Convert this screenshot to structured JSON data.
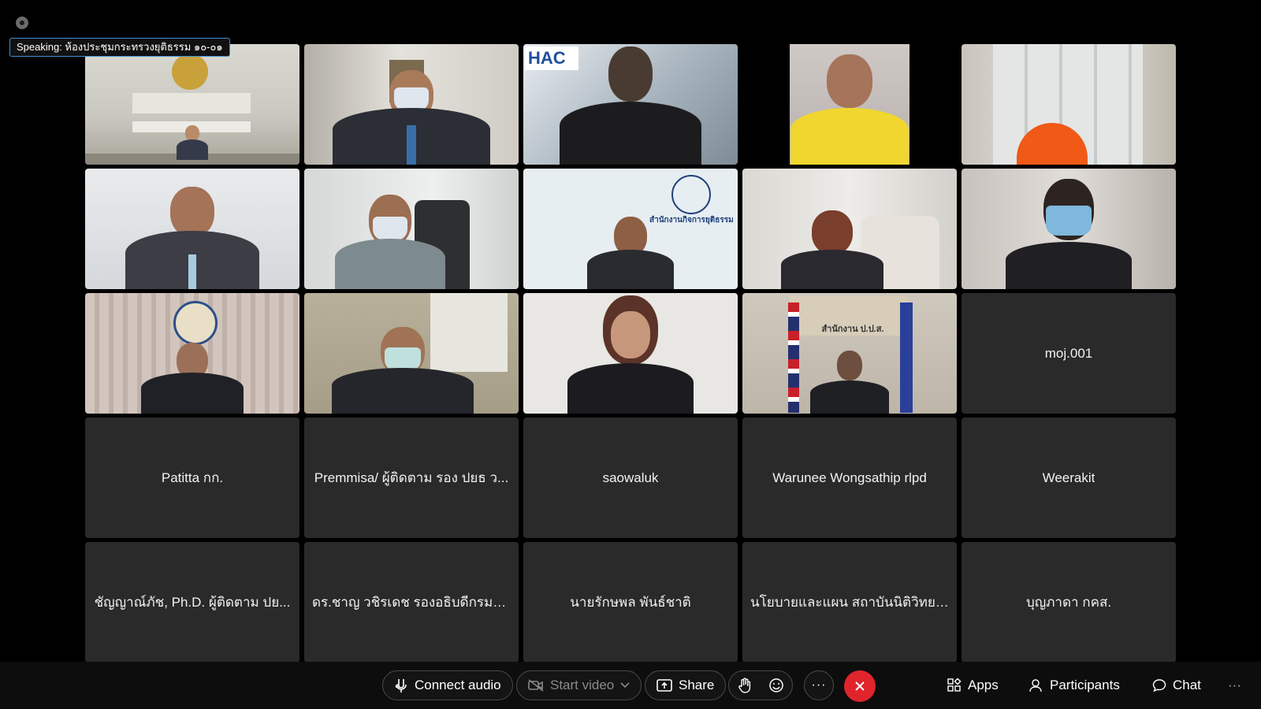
{
  "speaking": {
    "text": "Speaking: ห้องประชุมกระทรวงยุติธรรม ๑๐-๐๑"
  },
  "tiles": [
    {
      "id": "t1"
    },
    {
      "id": "t2",
      "logo": "HAC"
    },
    {
      "id": "t3"
    },
    {
      "id": "t4"
    },
    {
      "id": "t5"
    },
    {
      "id": "t6"
    },
    {
      "id": "t7"
    },
    {
      "id": "t8",
      "sign": "สำนักงานกิจการยุติธรรม"
    },
    {
      "id": "t9"
    },
    {
      "id": "t10"
    },
    {
      "id": "t11"
    },
    {
      "id": "t12"
    },
    {
      "id": "t13"
    },
    {
      "id": "t14",
      "sign": "สำนักงาน ป.ป.ส."
    },
    {
      "id": "t15",
      "name": "moj.001"
    }
  ],
  "name_tiles": [
    "Patitta กก.",
    "Premmisa/ ผู้ติดตาม รอง ปยธ ว...",
    "saowaluk",
    "Warunee Wongsathip rlpd",
    "Weerakit",
    "ชัญญาณ์ภัช, Ph.D. ผู้ติดตาม ปย...",
    "ดร.ชาญ วชิรเดช รองอธิบดีกรมรา...",
    "นายรักษพล พันธ์ชาติ",
    "นโยบายและแผน สถาบันนิติวิทยาศ...",
    "บุญภาดา กคส."
  ],
  "toolbar": {
    "connect_audio": "Connect audio",
    "start_video": "Start video",
    "share": "Share",
    "more": "···",
    "apps": "Apps",
    "participants": "Participants",
    "chat": "Chat",
    "overflow": "···"
  },
  "colors": {
    "end_call": "#e0242b",
    "speaking_border": "#3d8fd6"
  }
}
